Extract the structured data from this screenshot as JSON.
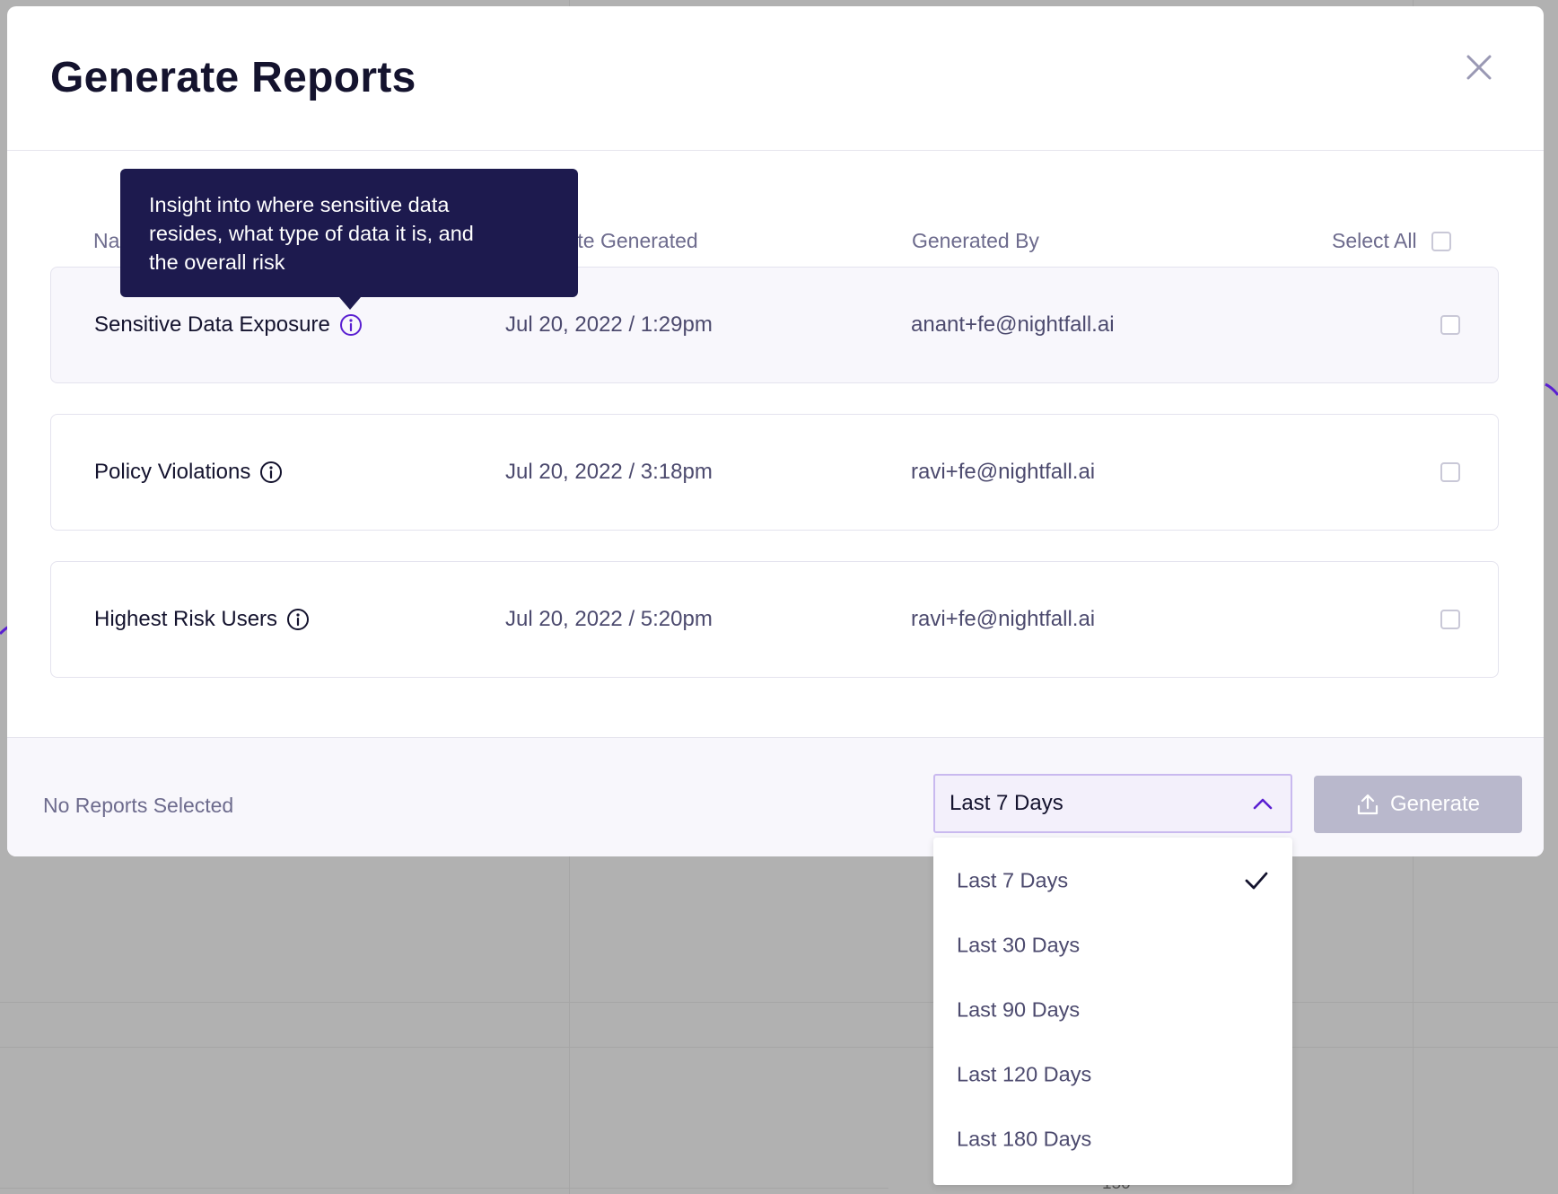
{
  "modal": {
    "title": "Generate Reports",
    "close_icon": "close-icon"
  },
  "table": {
    "columns": {
      "name": "Name",
      "date": "Date Generated",
      "by": "Generated By",
      "select_all": "Select All"
    },
    "rows": [
      {
        "name": "Sensitive Data Exposure",
        "date": "Jul 20, 2022 / 1:29pm",
        "by": "anant+fe@nightfall.ai",
        "icon": "info-icon",
        "checked": false
      },
      {
        "name": "Policy Violations",
        "date": "Jul 20, 2022 / 3:18pm",
        "by": "ravi+fe@nightfall.ai",
        "icon": "info-icon",
        "checked": false
      },
      {
        "name": "Highest Risk Users",
        "date": "Jul 20, 2022 / 5:20pm",
        "by": "ravi+fe@nightfall.ai",
        "icon": "info-icon",
        "checked": false
      }
    ]
  },
  "tooltip": {
    "lines": [
      "Insight into where sensitive data",
      "resides, what type of data it is, and",
      "the overall risk"
    ]
  },
  "footer": {
    "status": "No Reports Selected",
    "range_select": {
      "value": "Last 7 Days",
      "options": [
        "Last 7 Days",
        "Last 30 Days",
        "Last 90 Days",
        "Last 120 Days",
        "Last 180 Days"
      ],
      "selected_index": 0
    },
    "generate_label": "Generate",
    "generate_icon": "upload-icon"
  },
  "backdrop": {
    "axis_tick": "150"
  },
  "colors": {
    "accent": "#5a1fd1",
    "tooltip_bg": "#1d1a4e",
    "button_disabled": "#b9b8cc",
    "title": "#14132e"
  }
}
